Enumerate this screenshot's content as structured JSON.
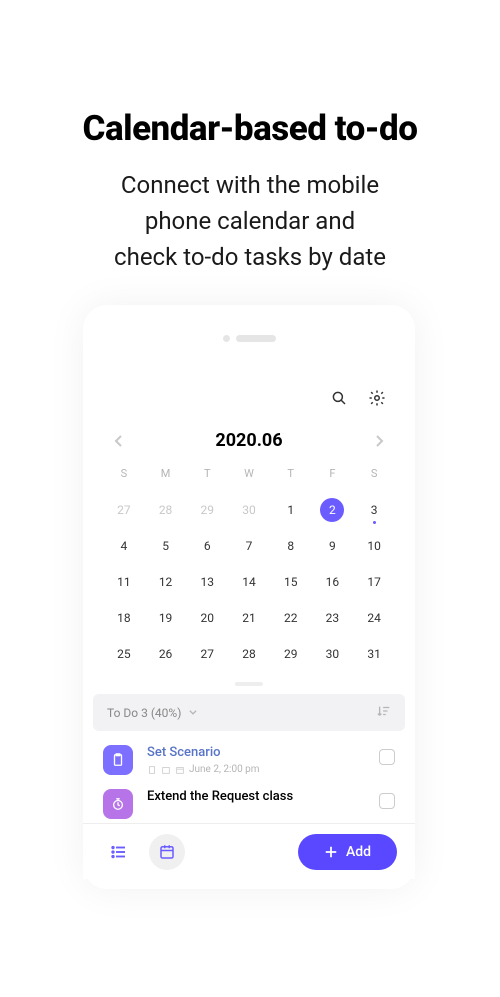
{
  "hero": {
    "title": "Calendar-based to-do",
    "subtitle_line1": "Connect with the mobile",
    "subtitle_line2": "phone calendar and",
    "subtitle_line3": "check to-do tasks by date"
  },
  "calendar": {
    "title": "2020.06",
    "weekdays": [
      "S",
      "M",
      "T",
      "W",
      "T",
      "F",
      "S"
    ],
    "selected_day": 2,
    "dot_day": 3,
    "weeks": [
      [
        {
          "n": 27,
          "off": true
        },
        {
          "n": 28,
          "off": true
        },
        {
          "n": 29,
          "off": true
        },
        {
          "n": 30,
          "off": true
        },
        {
          "n": 1
        },
        {
          "n": 2,
          "sel": true
        },
        {
          "n": 3,
          "dot": true
        }
      ],
      [
        {
          "n": 4
        },
        {
          "n": 5
        },
        {
          "n": 6
        },
        {
          "n": 7
        },
        {
          "n": 8
        },
        {
          "n": 9
        },
        {
          "n": 10
        }
      ],
      [
        {
          "n": 11
        },
        {
          "n": 12
        },
        {
          "n": 13
        },
        {
          "n": 14
        },
        {
          "n": 15
        },
        {
          "n": 16
        },
        {
          "n": 17
        }
      ],
      [
        {
          "n": 18
        },
        {
          "n": 19
        },
        {
          "n": 20
        },
        {
          "n": 21
        },
        {
          "n": 22
        },
        {
          "n": 23
        },
        {
          "n": 24
        }
      ],
      [
        {
          "n": 25
        },
        {
          "n": 26
        },
        {
          "n": 27
        },
        {
          "n": 28
        },
        {
          "n": 29
        },
        {
          "n": 30
        },
        {
          "n": 31
        }
      ]
    ]
  },
  "filter": {
    "label": "To Do 3 (40%)"
  },
  "todos": [
    {
      "title": "Set Scenario",
      "meta": "June 2, 2:00 pm",
      "highlighted": true
    },
    {
      "title": "Extend the Request class",
      "meta": "",
      "highlighted": false
    }
  ],
  "add_label": "Add"
}
